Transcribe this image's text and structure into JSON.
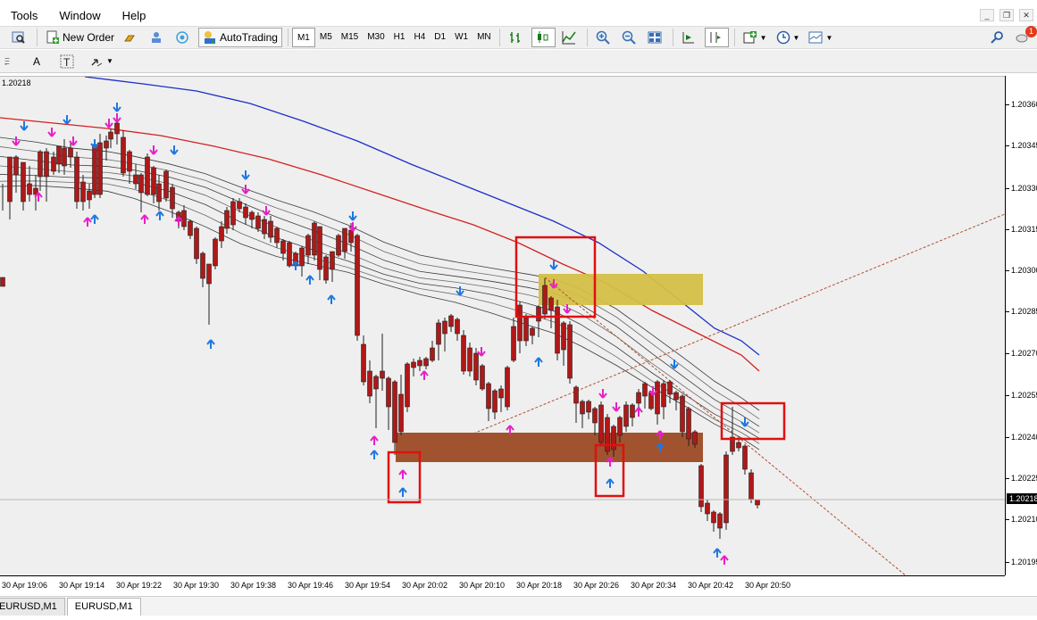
{
  "menu": {
    "tools": "Tools",
    "window": "Window",
    "help": "Help"
  },
  "toolbar": {
    "new_order": "New Order",
    "auto_trading": "AutoTrading",
    "periods": [
      "M1",
      "M5",
      "M15",
      "M30",
      "H1",
      "H4",
      "D1",
      "W1",
      "MN"
    ],
    "active_period": "M1",
    "notification_count": "1"
  },
  "toolbar2": {
    "text_tool": "A",
    "text_label_tool": "T"
  },
  "chart": {
    "symbol_price_corner": "1.20218",
    "current_price": "1.20218",
    "price_labels": [
      "1.20360",
      "1.20345",
      "1.20330",
      "1.20315",
      "1.20300",
      "1.20285",
      "1.20270",
      "1.20255",
      "1.20240",
      "1.20225",
      "1.20210",
      "1.20195"
    ],
    "time_labels": [
      "30 Apr 19:06",
      "30 Apr 19:14",
      "30 Apr 19:22",
      "30 Apr 19:30",
      "30 Apr 19:38",
      "30 Apr 19:46",
      "30 Apr 19:54",
      "30 Apr 20:02",
      "30 Apr 20:10",
      "30 Apr 20:18",
      "30 Apr 20:26",
      "30 Apr 20:34",
      "30 Apr 20:42",
      "30 Apr 20:50"
    ],
    "colors": {
      "bull_candle": "#9be05a",
      "bear_candle": "#b01818",
      "blue_ma": "#1a2fc9",
      "red_ma": "#d42020",
      "arrow_up_blue": "#1e78e0",
      "arrow_magenta": "#e81fc8",
      "supply_zone": "#d4bf46",
      "demand_zone": "#9c4a24",
      "highlight_box": "#e01010"
    }
  },
  "tabs": [
    {
      "label": "EURUSD,M1"
    },
    {
      "label": "EURUSD,M1"
    }
  ],
  "active_tab": 1
}
